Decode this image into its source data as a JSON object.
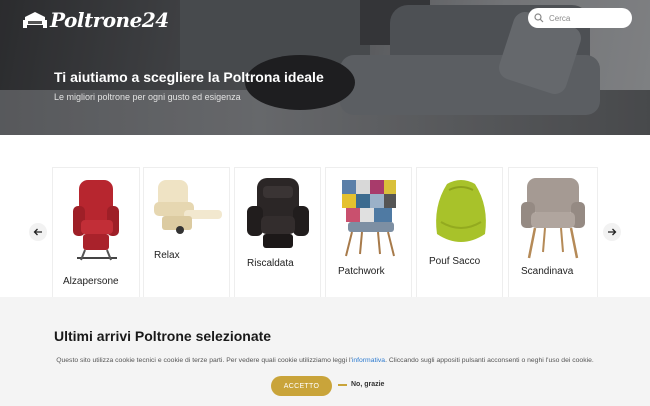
{
  "header": {
    "logo_text": "Poltrone24",
    "search_placeholder": "Cerca"
  },
  "hero": {
    "title": "Ti aiutiamo a scegliere la Poltrona ideale",
    "subtitle": "Le migliori poltrone per ogni gusto ed esigenza"
  },
  "categories": [
    {
      "label": "Alzapersone",
      "color": "#b7262f"
    },
    {
      "label": "Relax",
      "color": "#efe3c4"
    },
    {
      "label": "Riscaldata",
      "color": "#2b2626"
    },
    {
      "label": "Patchwork",
      "color": "#5b7fa8"
    },
    {
      "label": "Pouf Sacco",
      "color": "#a8c22a"
    },
    {
      "label": "Scandinava",
      "color": "#a59a93"
    }
  ],
  "section": {
    "title": "Ultimi arrivi Poltrone selezionate"
  },
  "cookie": {
    "text_before": "Questo sito utilizza cookie tecnici e cookie di terze parti. Per vedere quali cookie utilizziamo leggi l'",
    "link": "informativa",
    "text_after": ". Cliccando sugli appositi pulsanti acconsenti o neghi l'uso dei cookie.",
    "accept_label": "ACCETTO",
    "refuse_label": "No, grazie"
  },
  "icons": {
    "logo": "sofa-icon",
    "search": "search-icon",
    "prev": "arrow-left-icon",
    "next": "arrow-right-icon"
  }
}
